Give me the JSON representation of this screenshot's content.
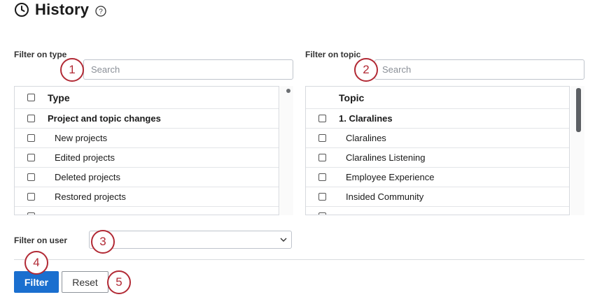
{
  "page": {
    "title": "History"
  },
  "type_filter": {
    "label": "Filter on type",
    "search_placeholder": "Search",
    "header": "Type",
    "rows": [
      {
        "label": "Project and topic changes",
        "kind": "group"
      },
      {
        "label": "New projects",
        "kind": "child"
      },
      {
        "label": "Edited projects",
        "kind": "child"
      },
      {
        "label": "Deleted projects",
        "kind": "child"
      },
      {
        "label": "Restored projects",
        "kind": "child"
      }
    ]
  },
  "topic_filter": {
    "label": "Filter on topic",
    "search_placeholder": "Search",
    "header": "Topic",
    "rows": [
      {
        "label": "1. Claralines",
        "kind": "group"
      },
      {
        "label": "Claralines",
        "kind": "child"
      },
      {
        "label": "Claralines Listening",
        "kind": "child"
      },
      {
        "label": "Employee Experience",
        "kind": "child"
      },
      {
        "label": "Insided Community",
        "kind": "child"
      }
    ]
  },
  "user_filter": {
    "label": "Filter on user",
    "selected": ""
  },
  "actions": {
    "filter_label": "Filter",
    "reset_label": "Reset"
  },
  "callouts": [
    "1",
    "2",
    "3",
    "4",
    "5"
  ],
  "colors": {
    "primary": "#1a6fcf",
    "callout": "#b22a35"
  },
  "icons": {
    "title": "clock-icon",
    "help": "help-circle-icon",
    "select": "chevron-down-icon"
  }
}
